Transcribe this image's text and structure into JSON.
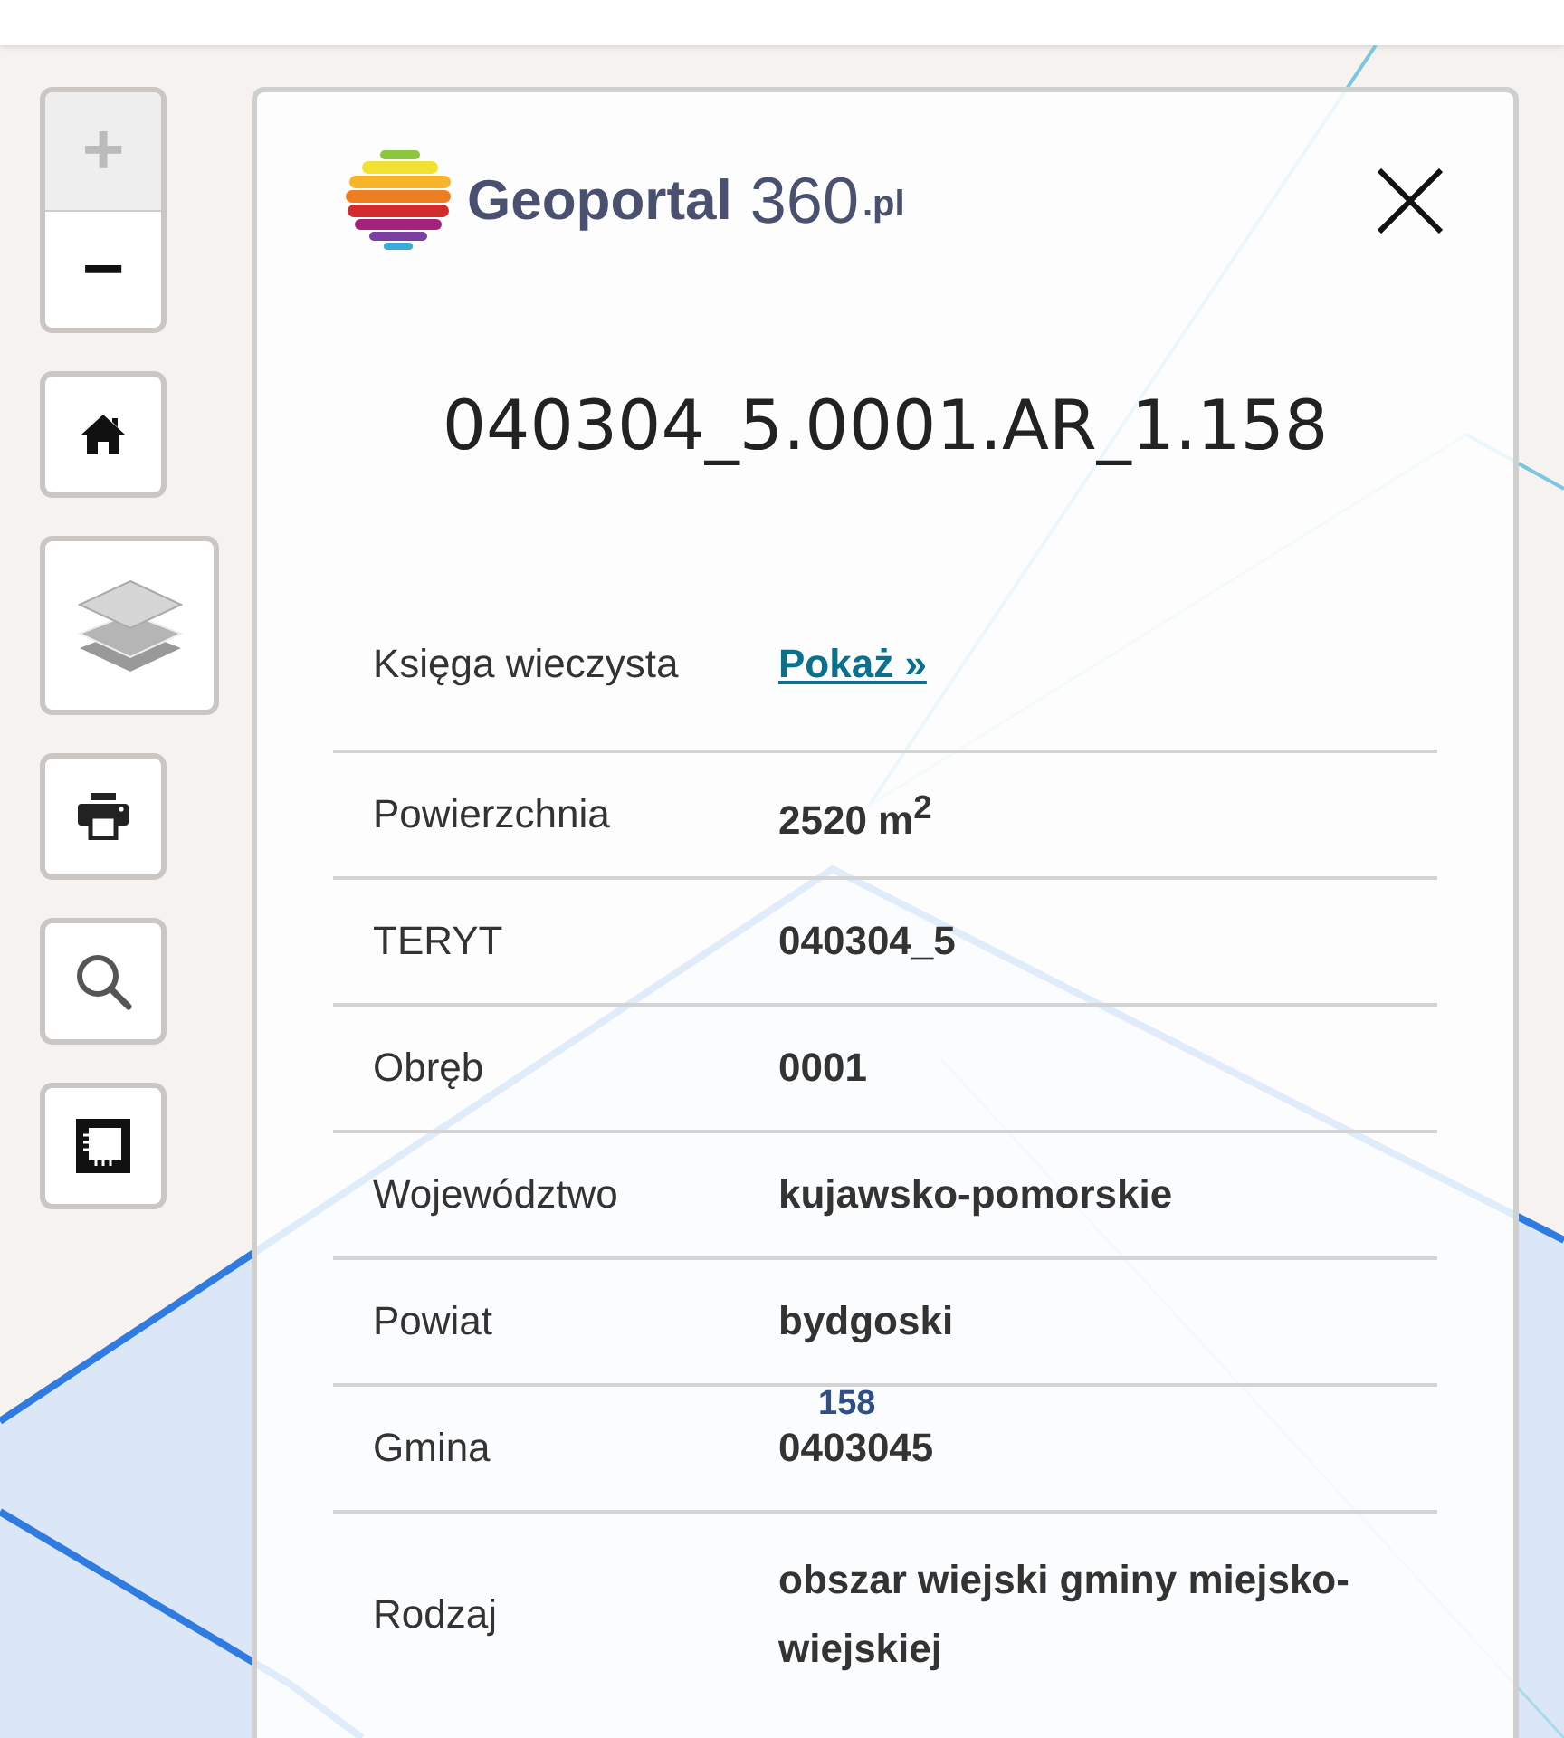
{
  "map_controls": {
    "zoom_in": {
      "label": "+",
      "disabled": true
    },
    "zoom_out": {
      "label": "−",
      "disabled": false
    },
    "tools": [
      {
        "kind": "home"
      },
      {
        "kind": "layers"
      },
      {
        "kind": "print"
      },
      {
        "kind": "search"
      },
      {
        "kind": "measure"
      }
    ]
  },
  "map_label": "158",
  "panel": {
    "logo": {
      "name": "Geoportal",
      "number": "360",
      "domain": ".pl"
    },
    "title": "040304_5.0001.AR_1.158",
    "rows": [
      {
        "label": "Księga wieczysta",
        "value": "Pokaż »",
        "kind": "link"
      },
      {
        "label": "Powierzchnia",
        "value": "2520 m$^{2}$",
        "kind": "text"
      },
      {
        "label": "TERYT",
        "value": "040304_5",
        "kind": "text"
      },
      {
        "label": "Obręb",
        "value": "0001",
        "kind": "text"
      },
      {
        "label": "Województwo",
        "value": "kujawsko-pomorskie",
        "kind": "text"
      },
      {
        "label": "Powiat",
        "value": "bydgoski",
        "kind": "text"
      },
      {
        "label": "Gmina",
        "value": "0403045",
        "kind": "text"
      },
      {
        "label": "Rodzaj",
        "value": "obszar wiejski gminy miejsko-wiejskiej",
        "kind": "text"
      }
    ]
  }
}
